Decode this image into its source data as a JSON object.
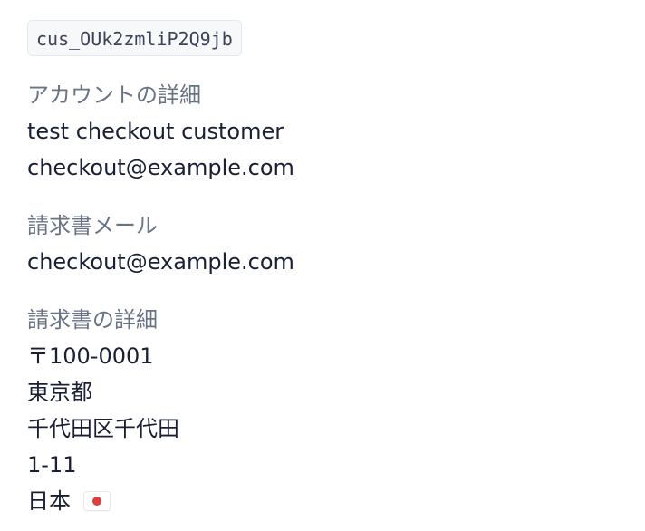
{
  "customer": {
    "id": "cus_OUk2zmliP2Q9jb"
  },
  "account_details": {
    "title": "アカウントの詳細",
    "name": "test checkout customer",
    "email": "checkout@example.com"
  },
  "invoice_email": {
    "title": "請求書メール",
    "email": "checkout@example.com"
  },
  "billing_details": {
    "title": "請求書の詳細",
    "postal_code": "〒100-0001",
    "prefecture": "東京都",
    "city": "千代田区千代田",
    "address_line": "1-11",
    "country": "日本",
    "country_flag_icon": "japan-flag-icon",
    "flag_color": "#d94040"
  }
}
